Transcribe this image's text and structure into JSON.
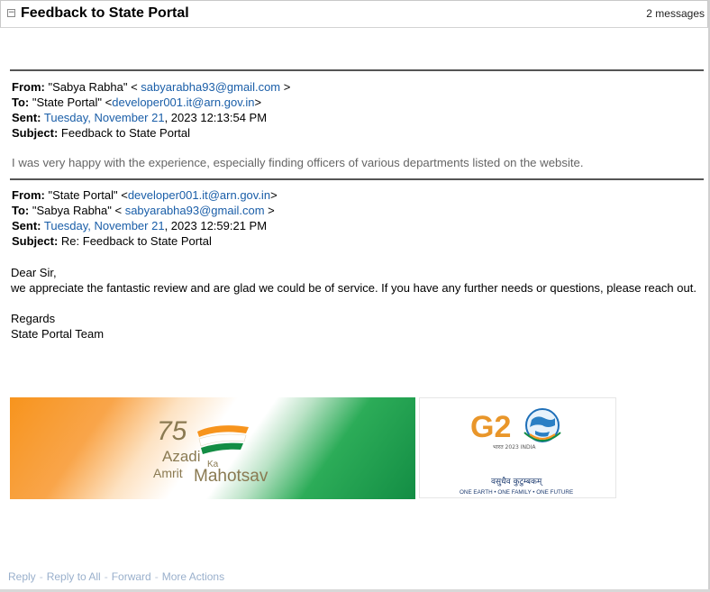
{
  "thread": {
    "title": "Feedback to State Portal",
    "message_count": "2 messages"
  },
  "messages": [
    {
      "from_label": "From:",
      "from_name": "\"Sabya Rabha\" < ",
      "from_email": "sabyarabha93@gmail.com",
      "from_tail": " >",
      "to_label": "To:",
      "to_name": "\"State Portal\" <",
      "to_email": "developer001.it@arn.gov.in",
      "to_tail": ">",
      "sent_label": "Sent:",
      "sent_day": "Tuesday, November 21",
      "sent_rest": ", 2023 12:13:54 PM",
      "subject_label": "Subject:",
      "subject": "Feedback to State Portal",
      "quoted_text": "I was very happy with the experience, especially finding officers of various departments listed on the website."
    },
    {
      "from_label": "From:",
      "from_name": "\"State Portal\" <",
      "from_email": "developer001.it@arn.gov.in",
      "from_tail": ">",
      "to_label": "To:",
      "to_name": "\"Sabya Rabha\" < ",
      "to_email": "sabyarabha93@gmail.com",
      "to_tail": " >",
      "sent_label": "Sent:",
      "sent_day": "Tuesday, November 21",
      "sent_rest": ", 2023 12:59:21 PM",
      "subject_label": "Subject:",
      "subject": "Re: Feedback to State Portal",
      "greeting": "Dear Sir,",
      "body": "we appreciate the fantastic review and are glad we could be of service. If you have any further needs or questions, please reach out.",
      "regards": "Regards",
      "signature": "State Portal Team"
    }
  ],
  "banners": {
    "azadi": {
      "number": "75",
      "line1": "Azadi",
      "ka": "Ka",
      "line2": "Amrit",
      "line3": "Mahotsav",
      "orange": "#f7941d",
      "green": "#138d44",
      "text_color": "#8a7a52"
    },
    "g20": {
      "letters": "G2",
      "hindi_year": "भारत 2023 INDIA",
      "motto_hindi": "वसुधैव कुटुम्बकम्",
      "motto": "ONE EARTH • ONE FAMILY • ONE FUTURE"
    }
  },
  "actions": {
    "reply": "Reply",
    "reply_all": "Reply to All",
    "forward": "Forward",
    "more": "More Actions"
  }
}
